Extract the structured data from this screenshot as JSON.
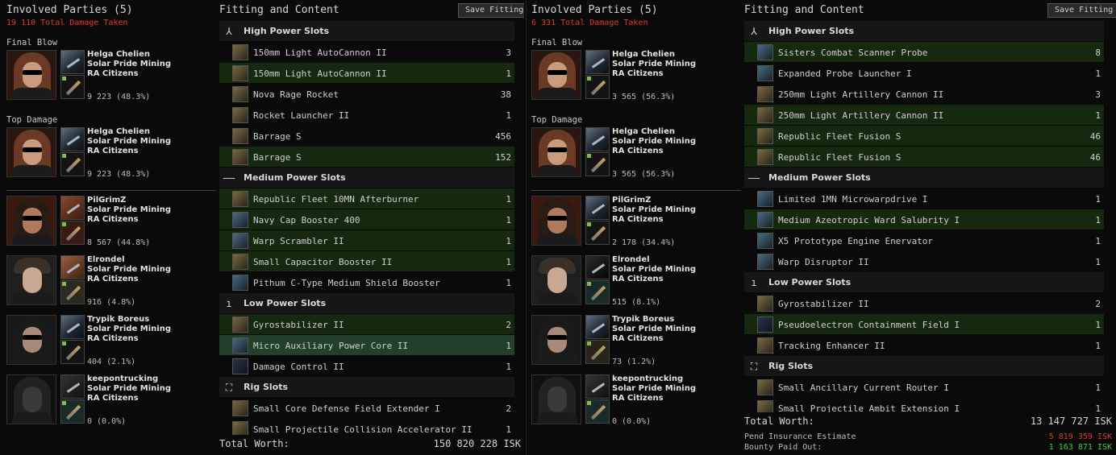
{
  "accent": {
    "damage_red": "#e23b2b",
    "bounty_green": "#3fcf3f",
    "fitted_green": "#15290f",
    "highlight": "#23402c"
  },
  "left": {
    "involved": {
      "title": "Involved Parties (5)",
      "damage": "19 110 Total Damage Taken",
      "final_blow_label": "Final Blow",
      "top_damage_label": "Top Damage",
      "final_blow": {
        "name": "Helga Chelien",
        "corp": "Solar Pride Mining",
        "alliance": "RA Citizens",
        "damage": "9 223 (48.3%)"
      },
      "top_damage": {
        "name": "Helga Chelien",
        "corp": "Solar Pride Mining",
        "alliance": "RA Citizens",
        "damage": "9 223 (48.3%)"
      },
      "attackers": [
        {
          "name": "PilGrimZ",
          "corp": "Solar Pride Mining",
          "alliance": "RA Citizens",
          "damage": "8 567 (44.8%)"
        },
        {
          "name": "Elrondel",
          "corp": "Solar Pride Mining",
          "alliance": "RA Citizens",
          "damage": "916 (4.8%)"
        },
        {
          "name": "Trypik Boreus",
          "corp": "Solar Pride Mining",
          "alliance": "RA Citizens",
          "damage": "404 (2.1%)"
        },
        {
          "name": "keepontrucking",
          "corp": "Solar Pride Mining",
          "alliance": "RA Citizens",
          "damage": "0 (0.0%)"
        }
      ]
    },
    "fitting": {
      "title": "Fitting and Content",
      "save_label": "Save Fitting",
      "sections": [
        {
          "name": "High Power Slots",
          "icon": "high-slot-icon",
          "glyph": "⅄",
          "items": [
            {
              "name": "150mm Light AutoCannon II",
              "qty": "3",
              "state": "destroyed"
            },
            {
              "name": "150mm Light AutoCannon II",
              "qty": "1",
              "state": "dropped"
            },
            {
              "name": "Nova Rage Rocket",
              "qty": "38",
              "state": "destroyed"
            },
            {
              "name": "Rocket Launcher II",
              "qty": "1",
              "state": "destroyed"
            },
            {
              "name": "Barrage S",
              "qty": "456",
              "state": "destroyed"
            },
            {
              "name": "Barrage S",
              "qty": "152",
              "state": "dropped"
            }
          ]
        },
        {
          "name": "Medium Power Slots",
          "icon": "mid-slot-icon",
          "glyph": "––",
          "items": [
            {
              "name": "Republic Fleet 10MN Afterburner",
              "qty": "1",
              "state": "dropped"
            },
            {
              "name": "Navy Cap Booster 400",
              "qty": "1",
              "state": "dropped"
            },
            {
              "name": "Warp Scrambler II",
              "qty": "1",
              "state": "dropped"
            },
            {
              "name": "Small Capacitor Booster II",
              "qty": "1",
              "state": "dropped"
            },
            {
              "name": "Pithum C-Type Medium Shield Booster",
              "qty": "1",
              "state": "destroyed"
            }
          ]
        },
        {
          "name": "Low Power Slots",
          "icon": "low-slot-icon",
          "glyph": "ı",
          "items": [
            {
              "name": "Gyrostabilizer II",
              "qty": "2",
              "state": "dropped"
            },
            {
              "name": "Micro Auxiliary Power Core II",
              "qty": "1",
              "state": "highlight"
            },
            {
              "name": "Damage Control II",
              "qty": "1",
              "state": "destroyed"
            }
          ]
        },
        {
          "name": "Rig Slots",
          "icon": "rig-slot-icon",
          "glyph": "⛶",
          "items": [
            {
              "name": "Small Core Defense Field Extender I",
              "qty": "2",
              "state": "destroyed"
            },
            {
              "name": "Small Projectile Collision Accelerator II",
              "qty": "1",
              "state": "destroyed"
            }
          ]
        }
      ],
      "total_label": "Total Worth:",
      "total_value": "150 820 228 ISK"
    }
  },
  "right": {
    "involved": {
      "title": "Involved Parties (5)",
      "damage": "6 331 Total Damage Taken",
      "final_blow_label": "Final Blow",
      "top_damage_label": "Top Damage",
      "final_blow": {
        "name": "Helga Chelien",
        "corp": "Solar Pride Mining",
        "alliance": "RA Citizens",
        "damage": "3 565 (56.3%)"
      },
      "top_damage": {
        "name": "Helga Chelien",
        "corp": "Solar Pride Mining",
        "alliance": "RA Citizens",
        "damage": "3 565 (56.3%)"
      },
      "attackers": [
        {
          "name": "PilGrimZ",
          "corp": "Solar Pride Mining",
          "alliance": "RA Citizens",
          "damage": "2 178 (34.4%)"
        },
        {
          "name": "Elrondel",
          "corp": "Solar Pride Mining",
          "alliance": "RA Citizens",
          "damage": "515 (8.1%)"
        },
        {
          "name": "Trypik Boreus",
          "corp": "Solar Pride Mining",
          "alliance": "RA Citizens",
          "damage": "73 (1.2%)"
        },
        {
          "name": "keepontrucking",
          "corp": "Solar Pride Mining",
          "alliance": "RA Citizens",
          "damage": "0 (0.0%)"
        }
      ]
    },
    "fitting": {
      "title": "Fitting and Content",
      "save_label": "Save Fitting",
      "sections": [
        {
          "name": "High Power Slots",
          "icon": "high-slot-icon",
          "glyph": "⅄",
          "items": [
            {
              "name": "Sisters Combat Scanner Probe",
              "qty": "8",
              "state": "dropped"
            },
            {
              "name": "Expanded Probe Launcher I",
              "qty": "1",
              "state": "destroyed"
            },
            {
              "name": "250mm Light Artillery Cannon II",
              "qty": "3",
              "state": "destroyed"
            },
            {
              "name": "250mm Light Artillery Cannon II",
              "qty": "1",
              "state": "dropped"
            },
            {
              "name": "Republic Fleet Fusion S",
              "qty": "46",
              "state": "dropped"
            },
            {
              "name": "Republic Fleet Fusion S",
              "qty": "46",
              "state": "dropped"
            }
          ]
        },
        {
          "name": "Medium Power Slots",
          "icon": "mid-slot-icon",
          "glyph": "––",
          "items": [
            {
              "name": "Limited 1MN Microwarpdrive I",
              "qty": "1",
              "state": "destroyed"
            },
            {
              "name": "Medium Azeotropic Ward Salubrity I",
              "qty": "1",
              "state": "dropped"
            },
            {
              "name": "X5 Prototype Engine Enervator",
              "qty": "1",
              "state": "destroyed"
            },
            {
              "name": "Warp Disruptor II",
              "qty": "1",
              "state": "destroyed"
            }
          ]
        },
        {
          "name": "Low Power Slots",
          "icon": "low-slot-icon",
          "glyph": "ı",
          "items": [
            {
              "name": "Gyrostabilizer II",
              "qty": "2",
              "state": "destroyed"
            },
            {
              "name": "Pseudoelectron Containment Field I",
              "qty": "1",
              "state": "dropped"
            },
            {
              "name": "Tracking Enhancer II",
              "qty": "1",
              "state": "destroyed"
            }
          ]
        },
        {
          "name": "Rig Slots",
          "icon": "rig-slot-icon",
          "glyph": "⛶",
          "items": [
            {
              "name": "Small Ancillary Current Router I",
              "qty": "1",
              "state": "destroyed"
            },
            {
              "name": "Small Projectile Ambit Extension I",
              "qty": "1",
              "state": "destroyed"
            }
          ]
        }
      ],
      "total_label": "Total Worth:",
      "total_value": "13 147 727 ISK",
      "insurance_label": "Pend Insurance Estimate",
      "insurance_value": "5 819 359 ISK",
      "bounty_label": "Bounty Paid Out:",
      "bounty_value": "1 163 871 ISK"
    }
  }
}
